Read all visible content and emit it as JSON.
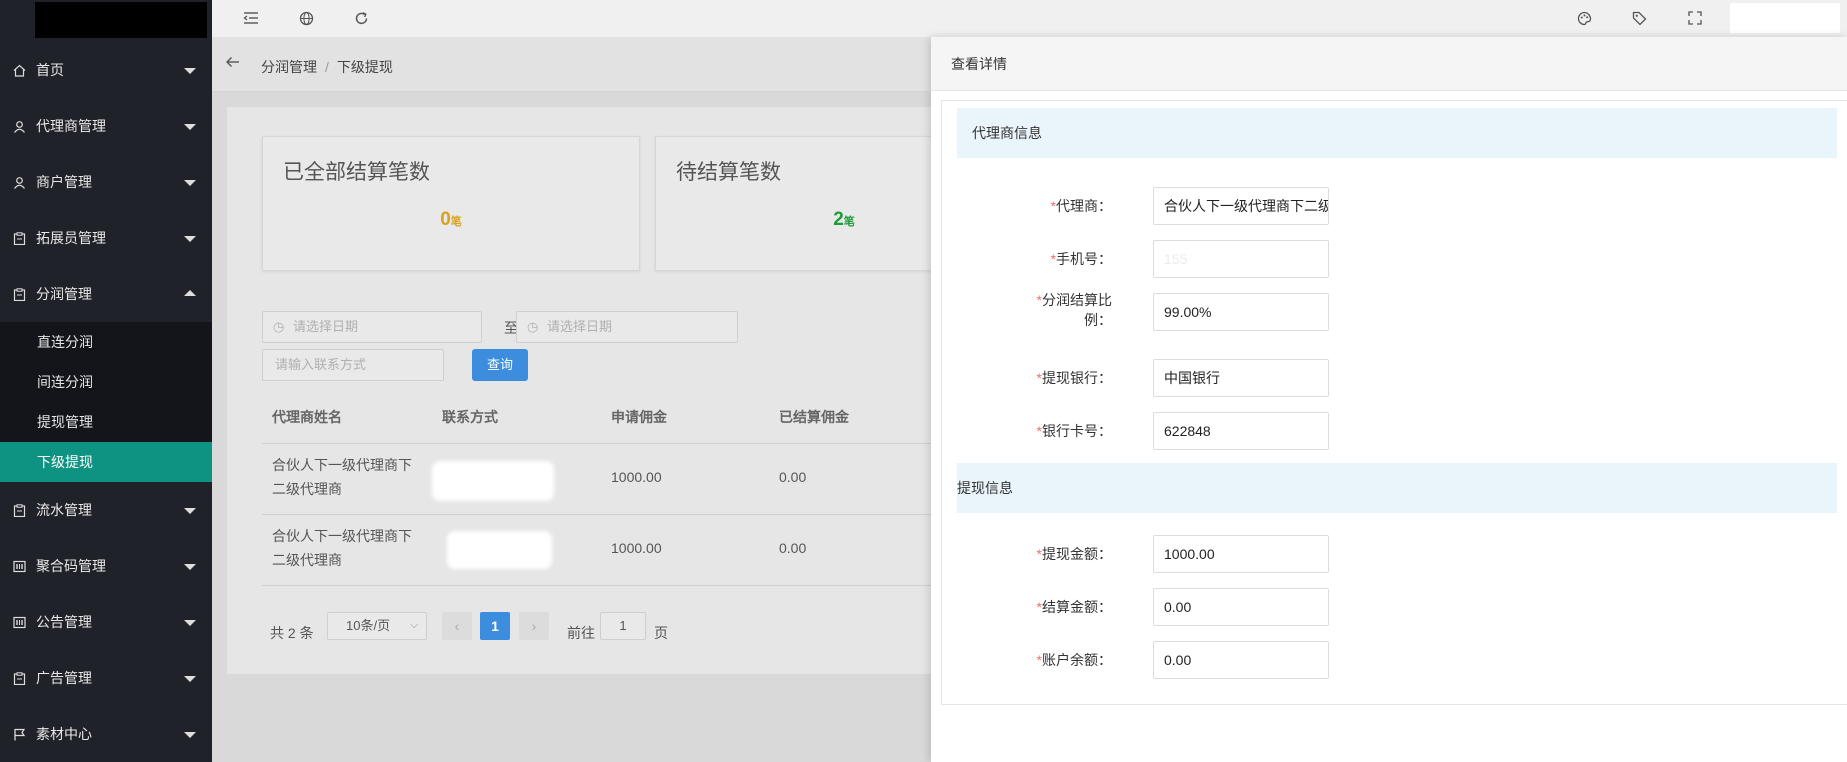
{
  "sidebar": {
    "items": [
      {
        "label": "首页",
        "icon": "home-icon"
      },
      {
        "label": "代理商管理",
        "icon": "user-icon"
      },
      {
        "label": "商户管理",
        "icon": "user-icon"
      },
      {
        "label": "拓展员管理",
        "icon": "clipboard-icon"
      },
      {
        "label": "分润管理",
        "icon": "clipboard-icon"
      },
      {
        "label": "流水管理",
        "icon": "clipboard-icon"
      },
      {
        "label": "聚合码管理",
        "icon": "qrcode-icon"
      },
      {
        "label": "公告管理",
        "icon": "qrcode-icon"
      },
      {
        "label": "广告管理",
        "icon": "clipboard-icon"
      },
      {
        "label": "素材中心",
        "icon": "flag-icon"
      }
    ],
    "submenu": [
      "直连分润",
      "间连分润",
      "提现管理",
      "下级提现"
    ],
    "active_submenu": "下级提现"
  },
  "topbar": {
    "icons": [
      "menu-fold-icon",
      "globe-icon",
      "refresh-icon",
      "palette-icon",
      "tag-icon",
      "fullscreen-icon"
    ]
  },
  "breadcrumb": {
    "parent": "分润管理",
    "current": "下级提现"
  },
  "cards": [
    {
      "title": "已全部结算笔数",
      "value": "0",
      "unit": "笔",
      "color": "#d9a21b"
    },
    {
      "title": "待结算笔数",
      "value": "2",
      "unit": "笔",
      "color": "#1e9b3a"
    }
  ],
  "filters": {
    "start_placeholder": "请选择日期",
    "to_label": "至",
    "end_placeholder": "请选择日期",
    "contact_placeholder": "请输入联系方式",
    "query_label": "查询"
  },
  "table": {
    "headers": [
      "代理商姓名",
      "联系方式",
      "申请佣金",
      "已结算佣金"
    ],
    "rows": [
      {
        "name_line1": "合伙人下一级代理商下",
        "name_line2": "二级代理商",
        "contact": "",
        "apply": "1000.00",
        "settled": "0.00"
      },
      {
        "name_line1": "合伙人下一级代理商下",
        "name_line2": "二级代理商",
        "contact": "",
        "apply": "1000.00",
        "settled": "0.00"
      }
    ]
  },
  "pagination": {
    "total": "共 2 条",
    "page_size": "10条/页",
    "current_page": "1",
    "goto_label": "前往",
    "goto_value": "1",
    "page_label": "页"
  },
  "drawer": {
    "title": "查看详情",
    "section_agent": "代理商信息",
    "section_withdraw": "提现信息",
    "fields": {
      "agent": {
        "label": "代理商：",
        "value": "合伙人下一级代理商下二级"
      },
      "phone": {
        "label": "手机号：",
        "value": "155"
      },
      "ratio_line1": "分润结算比",
      "ratio_line2": "例：",
      "ratio_value": "99.00%",
      "bank": {
        "label": "提现银行：",
        "value": "中国银行"
      },
      "card": {
        "label": "银行卡号：",
        "value": "622848"
      },
      "amount": {
        "label": "提现金额：",
        "value": "1000.00"
      },
      "settle": {
        "label": "结算金额：",
        "value": "0.00"
      },
      "balance": {
        "label": "账户余额：",
        "value": "0.00"
      }
    },
    "required_mark": "*"
  }
}
